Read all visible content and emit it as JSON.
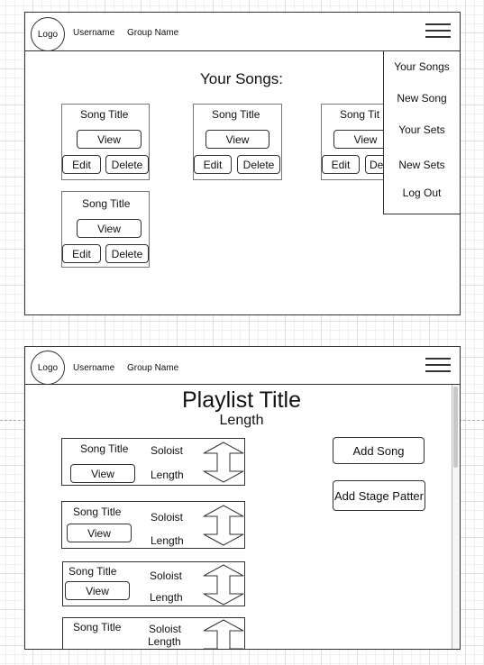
{
  "header": {
    "logo": "Logo",
    "username": "Username",
    "group": "Group Name"
  },
  "songs_page": {
    "title": "Your Songs:",
    "cards": [
      {
        "title": "Song Title",
        "view": "View",
        "edit": "Edit",
        "delete": "Delete"
      },
      {
        "title": "Song Title",
        "view": "View",
        "edit": "Edit",
        "delete": "Delete"
      },
      {
        "title": "Song Tit",
        "view": "View",
        "edit": "Edit",
        "delete": "De"
      },
      {
        "title": "Song Title",
        "view": "View",
        "edit": "Edit",
        "delete": "Delete"
      }
    ]
  },
  "menu": {
    "items": [
      "Your Songs",
      "New Song",
      "Your Sets",
      "New Sets",
      "Log Out"
    ]
  },
  "playlist_page": {
    "title": "Playlist Title",
    "length": "Length",
    "add_song": "Add Song",
    "add_stage": "Add Stage Patter",
    "rows": [
      {
        "song": "Song Title",
        "soloist": "Soloist",
        "view": "View",
        "length": "Length"
      },
      {
        "song": "Song Title",
        "soloist": "Soloist",
        "view": "View",
        "length": "Length"
      },
      {
        "song": "Song Title",
        "soloist": "Soloist",
        "view": "View",
        "length": "Length"
      },
      {
        "song": "Song Title",
        "soloist": "Soloist",
        "length": "Length"
      }
    ]
  }
}
